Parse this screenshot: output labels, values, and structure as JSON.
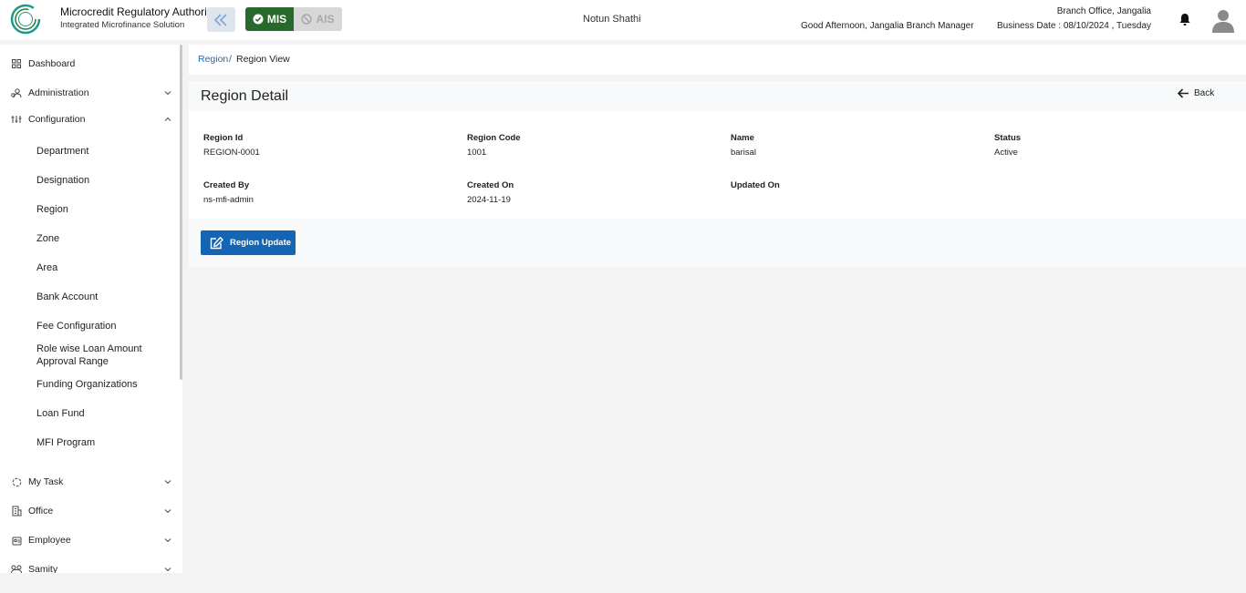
{
  "header": {
    "brand_title": "Microcredit Regulatory Authority",
    "brand_subtitle": "Integrated Microfinance Solution",
    "logo_text": "Microcredit Regulatory Authority",
    "mis_label": "MIS",
    "ais_label": "AIS",
    "app_name": "Notun Shathi",
    "greeting": "Good Afternoon, Jangalia Branch Manager",
    "branch": "Branch Office, Jangalia",
    "business_date": "Business Date : 08/10/2024 , Tuesday"
  },
  "sidebar": {
    "dashboard": "Dashboard",
    "administration": "Administration",
    "configuration": "Configuration",
    "config_items": [
      "Department",
      "Designation",
      "Region",
      "Zone",
      "Area",
      "Bank Account",
      "Fee Configuration",
      "Role wise Loan Amount Approval Range",
      "Funding Organizations",
      "Loan Fund",
      "MFI Program"
    ],
    "my_task": "My Task",
    "office": "Office",
    "employee": "Employee",
    "samity": "Samity"
  },
  "breadcrumb": {
    "parent": "Region",
    "separator": "/",
    "current": "Region View"
  },
  "detail": {
    "title": "Region Detail",
    "back_label": "Back",
    "fields": {
      "region_id": {
        "label": "Region Id",
        "value": "REGION-0001"
      },
      "region_code": {
        "label": "Region Code",
        "value": "1001"
      },
      "name": {
        "label": "Name",
        "value": "barisal"
      },
      "status": {
        "label": "Status",
        "value": "Active"
      },
      "created_by": {
        "label": "Created By",
        "value": "ns-mfi-admin"
      },
      "created_on": {
        "label": "Created On",
        "value": "2024-11-19"
      },
      "updated_on": {
        "label": "Updated On",
        "value": ""
      }
    },
    "update_button": "Region Update"
  },
  "colors": {
    "mis_green": "#276a2b",
    "primary_blue": "#1565b5",
    "link_blue": "#1e6bb8",
    "logo_teal": "#1a9a8a"
  },
  "icons": {
    "collapse": "double-chevron-left-icon",
    "mis": "check-circle-icon",
    "ais": "ban-icon",
    "notification": "bell-icon",
    "profile": "user-avatar-icon",
    "back": "arrow-left-icon",
    "edit": "edit-square-icon"
  }
}
